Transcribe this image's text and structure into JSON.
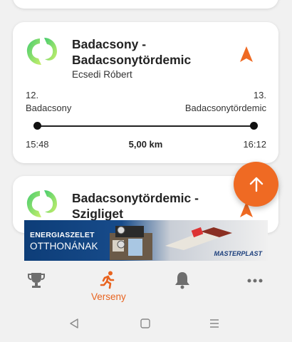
{
  "cards": [
    {
      "title": "Badacsony - Badacsonytördemic",
      "subtitle": "Ecsedi Róbert",
      "start_stop": "12.\nBadacsony",
      "end_stop": "13.\nBadacsonytördemic",
      "start_time": "15:48",
      "end_time": "16:12",
      "distance": "5,00 km"
    },
    {
      "title": "Badacsonytördemic - Szigliget"
    }
  ],
  "ad": {
    "line1": "ENERGIASZELET",
    "line2": "OTTHONÁNAK",
    "brand": "MASTERPLAST"
  },
  "bottom_nav": {
    "items": [
      {
        "icon": "trophy-icon",
        "label": ""
      },
      {
        "icon": "runner-icon",
        "label": "Verseny",
        "active": true
      },
      {
        "icon": "bell-icon",
        "label": ""
      },
      {
        "icon": "more-icon",
        "label": ""
      }
    ]
  },
  "colors": {
    "accent": "#ef6a23",
    "logo_gradient_start": "#4fcf6e",
    "logo_gradient_end": "#c6ee6c",
    "icon_gray": "#6e6e6e"
  }
}
